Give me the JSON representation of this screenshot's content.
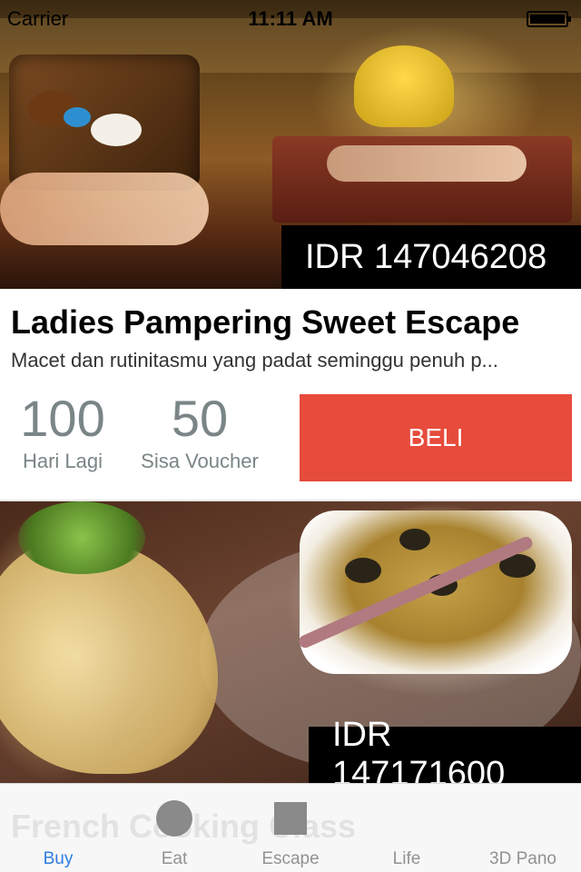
{
  "status_bar": {
    "carrier": "Carrier",
    "time": "11:11 AM"
  },
  "deals": [
    {
      "price": "IDR 147046208",
      "title": "Ladies Pampering Sweet Escape",
      "description": "Macet dan rutinitasmu yang padat seminggu penuh p...",
      "days_left": "100",
      "days_left_label": "Hari Lagi",
      "vouchers_left": "50",
      "vouchers_left_label": "Sisa Voucher",
      "buy_label": "BELI"
    },
    {
      "price": "IDR 147171600",
      "title": "French Cooking Class"
    }
  ],
  "tab_bar": {
    "tabs": [
      {
        "label": "Buy",
        "icon": "none",
        "active": true
      },
      {
        "label": "Eat",
        "icon": "circle-icon",
        "active": false
      },
      {
        "label": "Escape",
        "icon": "square-icon",
        "active": false
      },
      {
        "label": "Life",
        "icon": "none",
        "active": false
      },
      {
        "label": "3D Pano",
        "icon": "none",
        "active": false
      }
    ]
  },
  "colors": {
    "buy_button": "#e64b3c",
    "active_tab": "#2f7de1",
    "inactive_tab": "#929292",
    "stat_text": "#7a8586"
  }
}
